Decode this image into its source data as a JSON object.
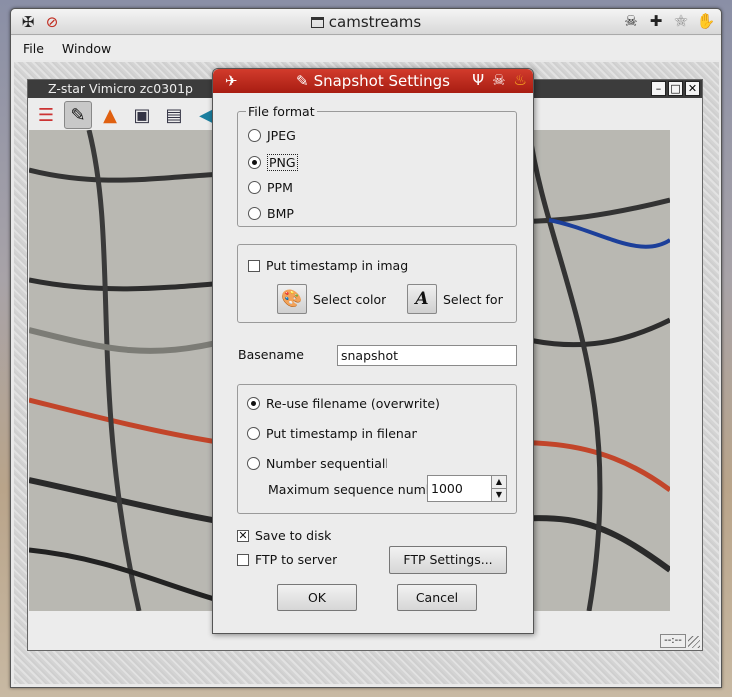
{
  "app": {
    "title": "camstreams",
    "menu": [
      "File",
      "Window"
    ]
  },
  "cam_window": {
    "title": "Z-star Vimicro zc0301p",
    "status": "--:--"
  },
  "dialog": {
    "title": "Snapshot Settings",
    "file_format": {
      "legend": "File format",
      "options": [
        "JPEG",
        "PNG",
        "PPM",
        "BMP"
      ],
      "selected": "PNG"
    },
    "timestamp": {
      "put_in_image_label": "Put timestamp in image",
      "put_in_image_checked": false,
      "select_color_label": "Select color",
      "select_font_label": "Select font"
    },
    "basename": {
      "label": "Basename",
      "value": "snapshot"
    },
    "naming": {
      "options": [
        "Re-use filename (overwrite)",
        "Put timestamp in filename",
        "Number sequentially"
      ],
      "selected": "Re-use filename (overwrite)",
      "max_seq_label": "Maximum sequence number",
      "max_seq_value": "1000"
    },
    "output": {
      "save_to_disk_label": "Save to disk",
      "save_to_disk_checked": true,
      "ftp_label": "FTP to server",
      "ftp_checked": false,
      "ftp_settings_label": "FTP Settings..."
    },
    "ok_label": "OK",
    "cancel_label": "Cancel"
  }
}
